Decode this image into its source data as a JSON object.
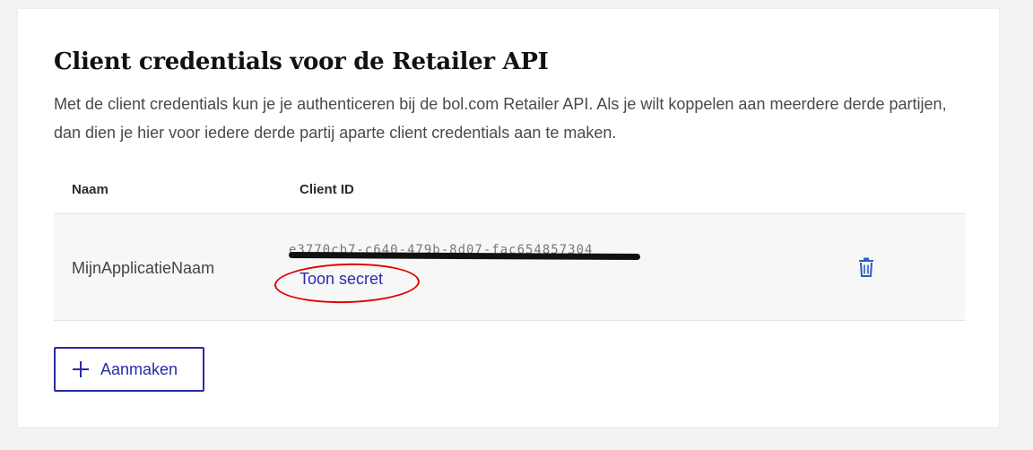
{
  "card": {
    "title": "Client credentials voor de Retailer API",
    "description": "Met de client credentials kun je je authenticeren bij de bol.com Retailer API. Als je wilt koppelen aan meerdere derde partijen, dan dien je hier voor iedere derde partij aparte client credentials aan te maken."
  },
  "table": {
    "headers": {
      "name": "Naam",
      "client_id": "Client ID"
    },
    "rows": [
      {
        "name": "MijnApplicatieNaam",
        "client_id": "e3770cb7-c640-479b-8d07-fac654857304",
        "show_secret_label": "Toon secret",
        "delete_icon": "trash-icon"
      }
    ]
  },
  "actions": {
    "create_label": "Aanmaken",
    "create_icon": "plus-icon"
  },
  "colors": {
    "link": "#2a2aa8",
    "annotation": "#e00000",
    "redaction": "#111111"
  }
}
